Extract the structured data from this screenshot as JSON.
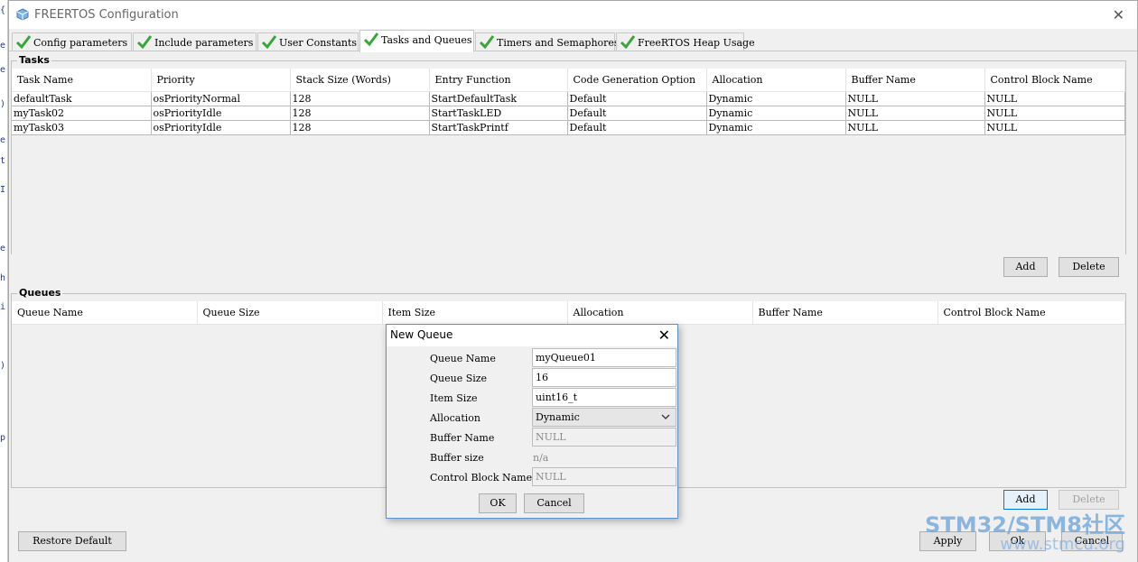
{
  "window": {
    "title": "FREERTOS Configuration"
  },
  "tabs": [
    {
      "label": "Config parameters"
    },
    {
      "label": "Include parameters"
    },
    {
      "label": "User Constants"
    },
    {
      "label": "Tasks and Queues"
    },
    {
      "label": "Timers and Semaphores"
    },
    {
      "label": "FreeRTOS Heap Usage"
    }
  ],
  "tasks": {
    "group_label": "Tasks",
    "columns": [
      "Task Name",
      "Priority",
      "Stack Size (Words)",
      "Entry Function",
      "Code Generation Option",
      "Allocation",
      "Buffer Name",
      "Control Block Name"
    ],
    "rows": [
      [
        "defaultTask",
        "osPriorityNormal",
        "128",
        "StartDefaultTask",
        "Default",
        "Dynamic",
        "NULL",
        "NULL"
      ],
      [
        "myTask02",
        "osPriorityIdle",
        "128",
        "StartTaskLED",
        "Default",
        "Dynamic",
        "NULL",
        "NULL"
      ],
      [
        "myTask03",
        "osPriorityIdle",
        "128",
        "StartTaskPrintf",
        "Default",
        "Dynamic",
        "NULL",
        "NULL"
      ]
    ],
    "add_label": "Add",
    "delete_label": "Delete"
  },
  "queues": {
    "group_label": "Queues",
    "columns": [
      "Queue Name",
      "Queue Size",
      "Item Size",
      "Allocation",
      "Buffer Name",
      "Control Block Name"
    ],
    "add_label": "Add",
    "delete_label": "Delete"
  },
  "footer": {
    "restore_label": "Restore Default",
    "apply_label": "Apply",
    "ok_label": "Ok",
    "cancel_label": "Cancel"
  },
  "dialog": {
    "title": "New Queue",
    "queue_name_label": "Queue Name",
    "queue_name_value": "myQueue01",
    "queue_size_label": "Queue Size",
    "queue_size_value": "16",
    "item_size_label": "Item Size",
    "item_size_value": "uint16_t",
    "allocation_label": "Allocation",
    "allocation_value": "Dynamic",
    "buffer_name_label": "Buffer Name",
    "buffer_name_value": "NULL",
    "buffer_size_label": "Buffer size",
    "buffer_size_value": "n/a",
    "control_block_label": "Control Block Name",
    "control_block_value": "NULL",
    "ok_label": "OK",
    "cancel_label": "Cancel"
  },
  "watermark": {
    "line1": "STM32/STM8社区",
    "line2": "www.stmcu.org"
  },
  "colors": {
    "check_green": "#3aa53a",
    "dialog_border": "#5a8fd0",
    "focus_blue": "#0078d7"
  }
}
